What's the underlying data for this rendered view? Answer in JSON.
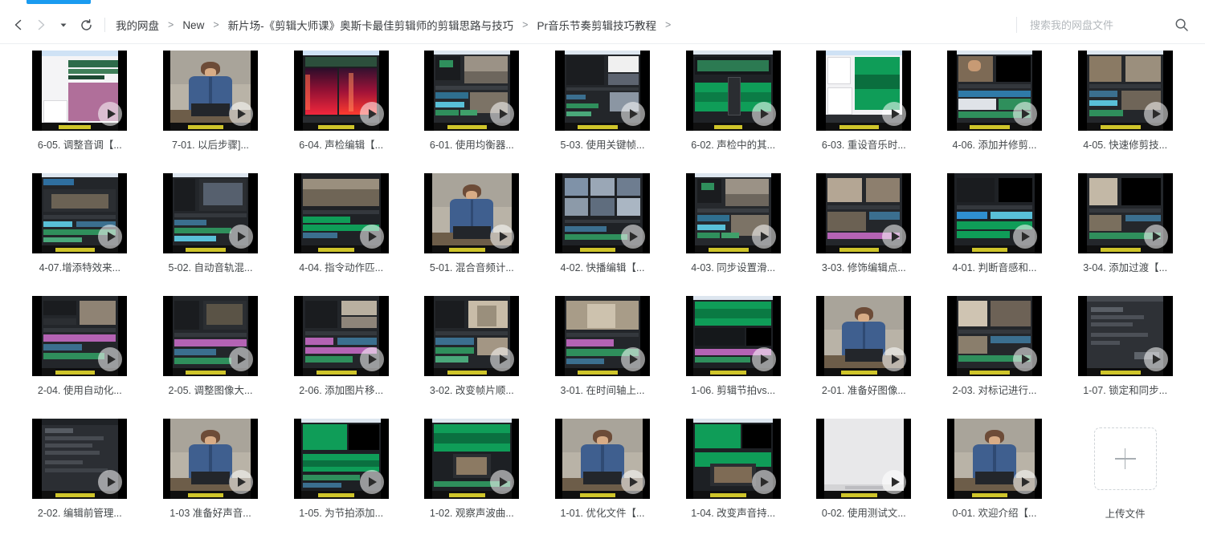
{
  "colors": {
    "accent": "#1a9bf0",
    "text": "#44484b",
    "muted": "#8a8f94",
    "thumb_bg": "#000000",
    "border": "#eceff1"
  },
  "header": {
    "nav": {
      "back_icon": "chevron-left-icon",
      "forward_icon": "chevron-right-icon",
      "history_icon": "caret-down-icon",
      "refresh_icon": "refresh-icon"
    },
    "breadcrumb": {
      "separator": ">",
      "items": [
        {
          "label": "我的网盘"
        },
        {
          "label": "New"
        },
        {
          "label": "新片场-《剪辑大师课》奥斯卡最佳剪辑师的剪辑思路与技巧"
        },
        {
          "label": "Pr音乐节奏剪辑技巧教程"
        }
      ],
      "trailing_separator": ">"
    },
    "search": {
      "placeholder": "搜索我的网盘文件",
      "value": "",
      "icon": "search-icon"
    }
  },
  "grid": {
    "play_overlay_icon": "play-icon",
    "files": [
      {
        "label": "6-05. 调整音调【...",
        "art": "daw-purple"
      },
      {
        "label": "7-01. 以后步骤]...",
        "art": "person"
      },
      {
        "label": "6-04. 声检编辑【...",
        "art": "spectrum-red"
      },
      {
        "label": "6-01. 使用均衡器...",
        "art": "timeline-dark"
      },
      {
        "label": "5-03. 使用关键帧...",
        "art": "timeline-dark2"
      },
      {
        "label": "6-02. 声检中的其...",
        "art": "wave-green"
      },
      {
        "label": "6-03. 重设音乐时...",
        "art": "wave-green2"
      },
      {
        "label": "4-06. 添加并修剪...",
        "art": "multicam"
      },
      {
        "label": "4-05. 快速修剪技...",
        "art": "multicam2"
      },
      {
        "label": "4-07.增添特效来...",
        "art": "timeline-blue"
      },
      {
        "label": "5-02. 自动音轨混...",
        "art": "timeline-blue2"
      },
      {
        "label": "4-04. 指令动作匹...",
        "art": "clip-green"
      },
      {
        "label": "5-01. 混合音频计...",
        "art": "person"
      },
      {
        "label": "4-02. 快播编辑【...",
        "art": "grid-clips"
      },
      {
        "label": "4-03. 同步设置滑...",
        "art": "timeline-dark"
      },
      {
        "label": "3-03. 修饰编辑点...",
        "art": "clip-room"
      },
      {
        "label": "4-01. 判断音感和...",
        "art": "timeline-green"
      },
      {
        "label": "3-04. 添加过渡【...",
        "art": "clip-room2"
      },
      {
        "label": "2-04. 使用自动化...",
        "art": "timeline-magenta"
      },
      {
        "label": "2-05. 调整图像大...",
        "art": "timeline-magenta2"
      },
      {
        "label": "2-06. 添加图片移...",
        "art": "clip-statue"
      },
      {
        "label": "3-02. 改变帧片顺...",
        "art": "clip-statue2"
      },
      {
        "label": "3-01. 在时间轴上...",
        "art": "clip-statue3"
      },
      {
        "label": "1-06. 剪辑节拍vs...",
        "art": "wave-green3"
      },
      {
        "label": "2-01. 准备好图像...",
        "art": "person"
      },
      {
        "label": "2-03. 对标记进行...",
        "art": "clip-room3"
      },
      {
        "label": "1-07. 锁定和同步...",
        "art": "ui-dark"
      },
      {
        "label": "2-02. 编辑前管理...",
        "art": "ui-dark2"
      },
      {
        "label": "1-03 准备好声音...",
        "art": "person"
      },
      {
        "label": "1-05. 为节拍添加...",
        "art": "wave-green4"
      },
      {
        "label": "1-02. 观察声波曲...",
        "art": "wave-green5"
      },
      {
        "label": "1-01. 优化文件【...",
        "art": "person"
      },
      {
        "label": "1-04. 改变声音持...",
        "art": "wave-green6"
      },
      {
        "label": "0-02. 使用测试文...",
        "art": "blank-white"
      },
      {
        "label": "0-01. 欢迎介绍【...",
        "art": "person"
      }
    ],
    "upload": {
      "label": "上传文件",
      "icon": "plus-icon"
    }
  }
}
